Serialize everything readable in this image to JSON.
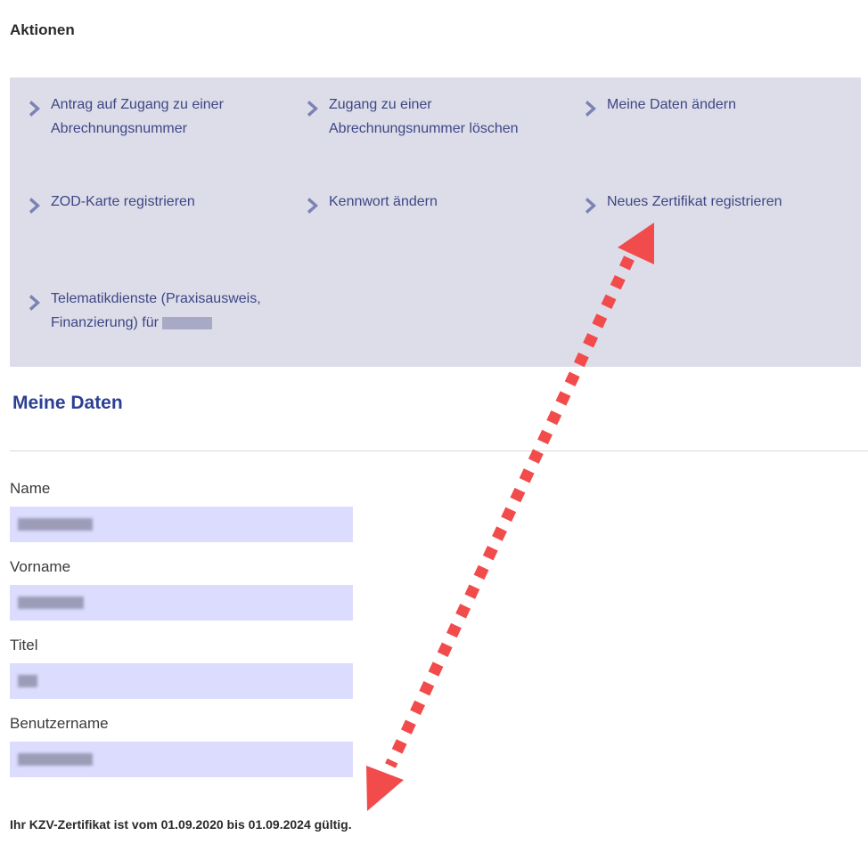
{
  "actions": {
    "title": "Aktionen",
    "items": [
      {
        "label": "Antrag auf Zugang zu einer\nAbrechnungsnummer"
      },
      {
        "label": "Zugang zu einer\nAbrechnungsnummer löschen"
      },
      {
        "label": "Meine Daten ändern"
      },
      {
        "label": "ZOD-Karte registrieren"
      },
      {
        "label": "Kennwort ändern"
      },
      {
        "label": "Neues Zertifikat registrieren"
      },
      {
        "label": "Telematikdienste (Praxisausweis,\nFinanzierung) für"
      }
    ],
    "chevron_icon": "chevron-right-icon"
  },
  "profile": {
    "heading": "Meine Daten",
    "fields": [
      {
        "label": "Name"
      },
      {
        "label": "Vorname"
      },
      {
        "label": "Titel"
      },
      {
        "label": "Benutzername"
      }
    ]
  },
  "certificate_note": "Ihr KZV-Zertifikat ist vom 01.09.2020 bis 01.09.2024 gültig.",
  "colors": {
    "panel_bg": "#dcdde9",
    "link": "#3f4684",
    "chevron": "#7d81b4",
    "heading": "#2c3f93",
    "input_bg": "#dcdcff",
    "annotation_arrow": "#f24b4b"
  }
}
